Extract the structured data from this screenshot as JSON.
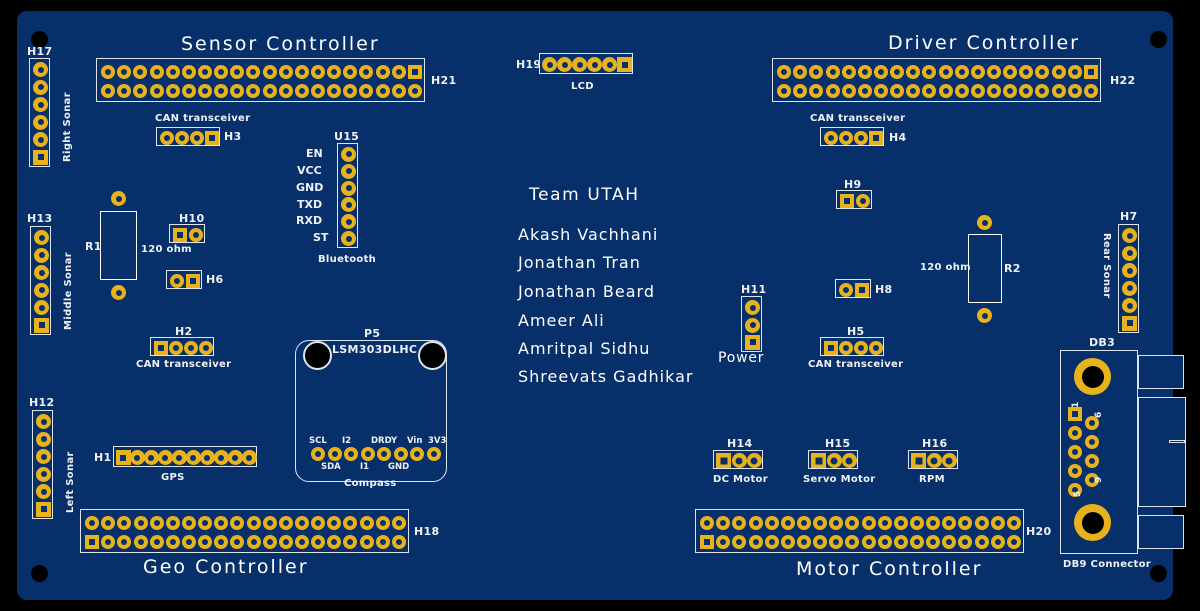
{
  "board": {
    "color": "#07306b",
    "silkscreen_color": "#ffffff",
    "pad_color": "#e8b21c",
    "background_color": "#000000"
  },
  "titles": {
    "sensor_controller": "Sensor Controller",
    "driver_controller": "Driver Controller",
    "geo_controller": "Geo Controller",
    "motor_controller": "Motor Controller"
  },
  "team": {
    "heading": "Team UTAH",
    "members": [
      "Akash Vachhani",
      "Jonathan Tran",
      "Jonathan Beard",
      "Ameer Ali",
      "Amritpal Sidhu",
      "Shreevats Gadhikar"
    ]
  },
  "connectors": {
    "h17": {
      "ref": "H17",
      "label": "Right Sonar",
      "pins": 6
    },
    "h13": {
      "ref": "H13",
      "label": "Middle Sonar",
      "pins": 6
    },
    "h12": {
      "ref": "H12",
      "label": "Left Sonar",
      "pins": 6
    },
    "h7": {
      "ref": "H7",
      "label": "Rear Sonar",
      "pins": 6
    },
    "h21": {
      "ref": "H21",
      "label": "",
      "pins": 40
    },
    "h22": {
      "ref": "H22",
      "label": "",
      "pins": 40
    },
    "h18": {
      "ref": "H18",
      "label": "",
      "pins": 40
    },
    "h20": {
      "ref": "H20",
      "label": "",
      "pins": 40
    },
    "h3": {
      "ref": "H3",
      "label": "CAN transceiver",
      "pins": 4
    },
    "h2": {
      "ref": "H2",
      "label": "CAN transceiver",
      "pins": 4
    },
    "h4": {
      "ref": "H4",
      "label": "CAN transceiver",
      "pins": 4
    },
    "h5": {
      "ref": "H5",
      "label": "CAN transceiver",
      "pins": 4
    },
    "h10": {
      "ref": "H10",
      "label": "",
      "pins": 2
    },
    "h6": {
      "ref": "H6",
      "label": "",
      "pins": 2
    },
    "h9": {
      "ref": "H9",
      "label": "",
      "pins": 2
    },
    "h8": {
      "ref": "H8",
      "label": "",
      "pins": 2
    },
    "h11": {
      "ref": "H11",
      "label": "Power",
      "pins": 3
    },
    "h14": {
      "ref": "H14",
      "label": "DC Motor",
      "pins": 3
    },
    "h15": {
      "ref": "H15",
      "label": "Servo Motor",
      "pins": 3
    },
    "h16": {
      "ref": "H16",
      "label": "RPM",
      "pins": 3
    },
    "h19": {
      "ref": "H19",
      "label": "LCD",
      "pins": 6
    },
    "h1": {
      "ref": "H1",
      "label": "GPS",
      "pins": 10
    }
  },
  "modules": {
    "bluetooth": {
      "ref": "U15",
      "label": "Bluetooth",
      "pins": [
        "EN",
        "VCC",
        "GND",
        "TXD",
        "RXD",
        "ST"
      ]
    },
    "compass": {
      "ref": "P5",
      "part": "LSM303DLHC",
      "label": "Compass",
      "pins_top": [
        "SCL",
        "I2",
        "DRDY",
        "Vin",
        "3V3"
      ],
      "pins_bottom": [
        "SDA",
        "I1",
        "GND"
      ]
    },
    "db9": {
      "ref": "DB3",
      "label": "DB9 Connector",
      "pin_first": "1",
      "pin_last_left": "5",
      "pin_first_right": "6",
      "pin_last_right": "9"
    }
  },
  "resistors": {
    "r1": {
      "ref": "R1",
      "value": "120 ohm"
    },
    "r2": {
      "ref": "R2",
      "value": "120 ohm"
    }
  }
}
